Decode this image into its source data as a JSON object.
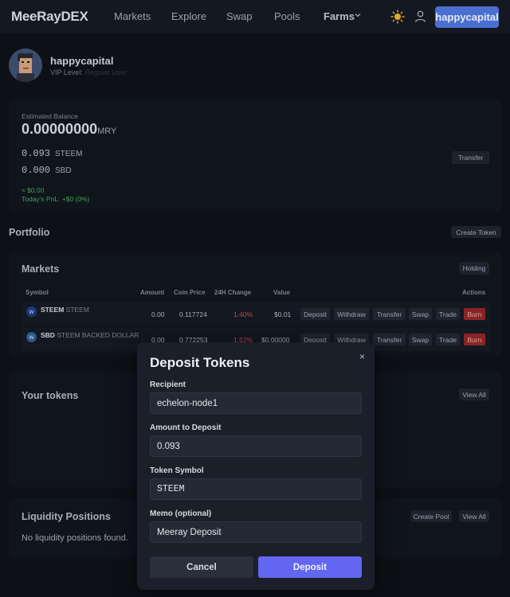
{
  "nav": {
    "logo": "MeeRayDEX",
    "links": [
      "Markets",
      "Explore",
      "Swap",
      "Pools"
    ],
    "farms": "Farms",
    "account": "happycapital"
  },
  "profile": {
    "username": "happycapital",
    "vip_label": "VIP Level:",
    "vip_value": "Regular User"
  },
  "balance": {
    "estimated_label": "Estimated Balance",
    "amount": "0.00000000",
    "unit": "MRY",
    "steem_amount": "0.093",
    "steem_symbol": "STEEM",
    "sbd_amount": "0.000",
    "sbd_symbol": "SBD",
    "usd": "≈ $0.00",
    "pnl": "Today's PnL: +$0 (0%)",
    "transfer": "Transfer"
  },
  "portfolio": {
    "title": "Portfolio",
    "create_token": "Create Token"
  },
  "markets": {
    "title": "Markets",
    "holding": "Holding",
    "columns": [
      "Symbol",
      "Amount",
      "Coin Price",
      "24H Change",
      "Value",
      "Actions"
    ],
    "rows": [
      {
        "symbol": "STEEM",
        "name": "STEEM",
        "amount": "0.00",
        "price": "0.117724",
        "change": "1.40%",
        "value": "$0.01"
      },
      {
        "symbol": "SBD",
        "name": "STEEM BACKED DOLLAR",
        "amount": "0.00",
        "price": "0.772253",
        "change": "1.52%",
        "value": "$0.00000"
      }
    ],
    "actions": [
      "Deposit",
      "Withdraw",
      "Transfer",
      "Swap",
      "Trade",
      "Burn"
    ]
  },
  "your_tokens": {
    "title": "Your tokens",
    "view_all": "View All"
  },
  "liquidity": {
    "title": "Liquidity Positions",
    "create_pool": "Create Pool",
    "view_all": "View All",
    "empty": "No liquidity positions found."
  },
  "modal": {
    "title": "Deposit Tokens",
    "close": "×",
    "recipient_label": "Recipient",
    "recipient_value": "echelon-node1",
    "amount_label": "Amount to Deposit",
    "amount_value": "0.093",
    "symbol_label": "Token Symbol",
    "symbol_value": "STEEM",
    "memo_label": "Memo (optional)",
    "memo_value": "Meeray Deposit",
    "cancel": "Cancel",
    "deposit": "Deposit"
  },
  "colors": {
    "accent": "#6366f1",
    "account_button": "#4b6fd1",
    "positive": "#3aa35e",
    "negative": "#b8504b",
    "burn": "#8a2424"
  }
}
